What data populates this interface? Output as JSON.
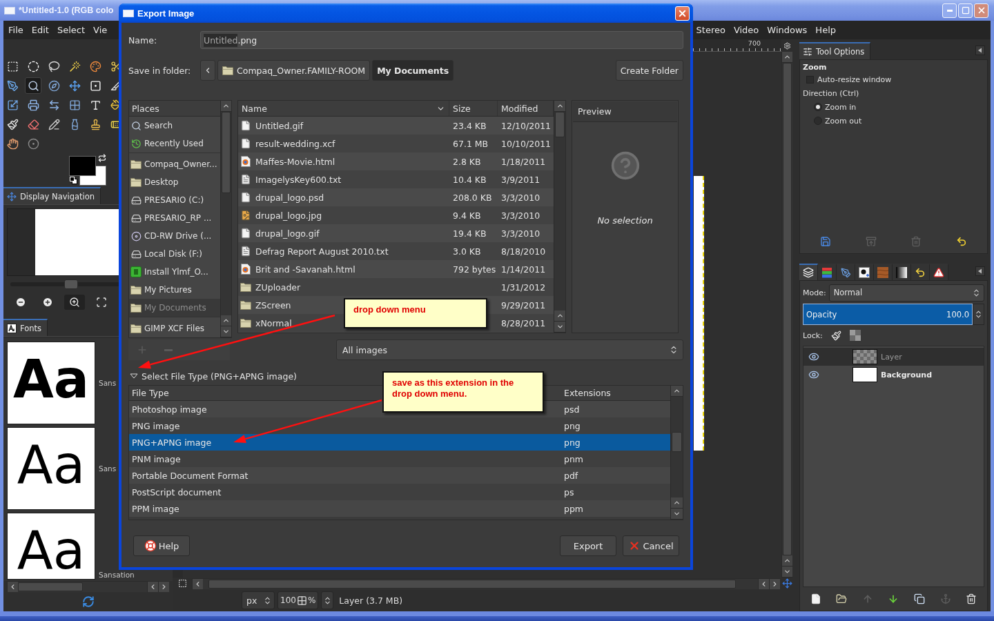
{
  "gimp_window": {
    "title": "*Untitled-1.0 (RGB colo",
    "menu_left": [
      "File",
      "Edit",
      "Select",
      "Vie"
    ],
    "menu_right": [
      "Stereo",
      "Video",
      "Windows",
      "Help"
    ]
  },
  "toolbox": {
    "tools": [
      {
        "kind": "rectangle",
        "selected": false
      },
      {
        "kind": "ellipse",
        "selected": false
      },
      {
        "kind": "lasso",
        "selected": false
      },
      {
        "kind": "wand",
        "selected": false
      },
      {
        "kind": "bycolor",
        "selected": false
      },
      {
        "kind": "scissors",
        "selected": false
      },
      {
        "kind": "paths",
        "selected": false
      },
      {
        "kind": "zoom",
        "selected": true
      },
      {
        "kind": "measure",
        "selected": false
      },
      {
        "kind": "move",
        "selected": false
      },
      {
        "kind": "align",
        "selected": false
      },
      {
        "kind": "crop",
        "selected": false
      },
      {
        "kind": "transform",
        "selected": false
      },
      {
        "kind": "perspective",
        "selected": false
      },
      {
        "kind": "flip",
        "selected": false
      },
      {
        "kind": "cage",
        "selected": false
      },
      {
        "kind": "text",
        "selected": false
      },
      {
        "kind": "bucket",
        "selected": false
      },
      {
        "kind": "brush",
        "selected": false
      },
      {
        "kind": "eraser",
        "selected": false
      },
      {
        "kind": "pencil",
        "selected": false
      },
      {
        "kind": "ink",
        "selected": false
      },
      {
        "kind": "clone",
        "selected": false
      },
      {
        "kind": "heal",
        "selected": false
      },
      {
        "kind": "smudge",
        "selected": false
      },
      {
        "kind": "dodge",
        "selected": false
      }
    ]
  },
  "navigation": {
    "tab": "Display Navigation",
    "level": 0.55,
    "buttons": [
      {
        "kind": "zoomout",
        "selected": false
      },
      {
        "kind": "zoomin",
        "selected": false
      },
      {
        "kind": "actual",
        "selected": true
      },
      {
        "kind": "fit",
        "selected": false
      }
    ]
  },
  "fonts": {
    "tab": "Fonts",
    "items": [
      {
        "sample": "Aa",
        "name": "Sans",
        "kind": "bold"
      },
      {
        "sample": "Aa",
        "name": "Sans",
        "kind": "regular"
      },
      {
        "sample": "Aa",
        "name": "Sansation",
        "kind": "regular"
      }
    ]
  },
  "canvas": {
    "ruler_label": "700"
  },
  "status_bar": {
    "unit": "px",
    "zoom": "100",
    "zoom_unit": "%",
    "info": "Layer (3.7 MB)"
  },
  "dock": {
    "tool_options": {
      "tab": "Tool Options",
      "tool": "Zoom",
      "auto_resize": {
        "label": "Auto-resize window",
        "checked": false
      },
      "direction_label": "Direction (Ctrl)",
      "direction": [
        {
          "label": "Zoom in",
          "selected": true
        },
        {
          "label": "Zoom out",
          "selected": false
        }
      ],
      "buttons": [
        {
          "kind": "save",
          "disabled": false
        },
        {
          "kind": "restore",
          "disabled": true
        },
        {
          "kind": "delete",
          "disabled": true
        },
        {
          "kind": "reset",
          "disabled": false
        }
      ]
    },
    "tabs": [
      {
        "kind": "layers",
        "selected": true
      },
      {
        "kind": "channels",
        "selected": false
      },
      {
        "kind": "paths",
        "selected": false
      },
      {
        "kind": "brushes",
        "selected": false
      },
      {
        "kind": "patterns",
        "selected": false
      },
      {
        "kind": "gradients",
        "selected": false
      },
      {
        "kind": "undo",
        "selected": false
      },
      {
        "kind": "errors",
        "selected": false
      }
    ],
    "mode": {
      "label": "Mode:",
      "value": "Normal"
    },
    "opacity": {
      "label": "Opacity",
      "value": "100.0",
      "level": 1
    },
    "lock_label": "Lock:",
    "layers": [
      {
        "name": "Layer",
        "visible": true,
        "selected": true,
        "has_alpha": true
      },
      {
        "name": "Background",
        "visible": true,
        "selected": false,
        "has_alpha": false
      }
    ],
    "buttons": [
      {
        "kind": "new",
        "disabled": false
      },
      {
        "kind": "open",
        "disabled": false
      },
      {
        "kind": "raise",
        "disabled": true
      },
      {
        "kind": "lower",
        "disabled": false
      },
      {
        "kind": "duplicate",
        "disabled": false
      },
      {
        "kind": "anchor",
        "disabled": true
      },
      {
        "kind": "delete",
        "disabled": false
      }
    ]
  },
  "dialog": {
    "title": "Export Image",
    "name_label": "Name:",
    "name_value": [
      {
        "text": "Untitled",
        "selected": true
      },
      {
        "text": ".png",
        "selected": false
      }
    ],
    "folder_label": "Save in folder:",
    "path": [
      {
        "label": "Compaq_Owner.FAMILY-ROOM",
        "selected": false
      },
      {
        "label": "My Documents",
        "selected": true
      }
    ],
    "create_folder": "Create Folder",
    "places": {
      "title": "Places",
      "groups": [
        {
          "items": [
            {
              "label": "Search",
              "kind": "search",
              "selected": false
            },
            {
              "label": "Recently Used",
              "kind": "recent",
              "selected": false
            }
          ]
        },
        {
          "items": [
            {
              "label": "Compaq_Owner...",
              "kind": "folder",
              "selected": false
            },
            {
              "label": "Desktop",
              "kind": "folder",
              "selected": false
            },
            {
              "label": "PRESARIO (C:)",
              "kind": "drive",
              "selected": false
            },
            {
              "label": "PRESARIO_RP ...",
              "kind": "drive",
              "selected": false
            },
            {
              "label": "CD-RW Drive (...",
              "kind": "cdrom",
              "selected": false
            },
            {
              "label": "Local Disk (F:)",
              "kind": "drive",
              "selected": false
            },
            {
              "label": "Install Ylmf_O...",
              "kind": "app",
              "selected": false
            },
            {
              "label": "My Pictures",
              "kind": "folder",
              "selected": false
            },
            {
              "label": "My Documents",
              "kind": "folder",
              "selected": true
            }
          ]
        },
        {
          "items": [
            {
              "label": "GIMP XCF Files",
              "kind": "folder",
              "selected": false
            }
          ]
        }
      ],
      "buttons": [
        {
          "kind": "add",
          "disabled": true
        },
        {
          "kind": "remove",
          "disabled": true
        }
      ]
    },
    "files": {
      "columns": [
        {
          "label": "Name",
          "sorted": true
        },
        {
          "label": "Size",
          "sorted": false
        },
        {
          "label": "Modified",
          "sorted": false
        }
      ],
      "rows": [
        {
          "kind": "file",
          "name": "Untitled.gif",
          "size": "23.4 KB",
          "modified": "12/10/2011"
        },
        {
          "kind": "file",
          "name": "result-wedding.xcf",
          "size": "67.1 MB",
          "modified": "10/10/2011"
        },
        {
          "kind": "web",
          "name": "Maffes-Movie.html",
          "size": "2.8 KB",
          "modified": "1/18/2011"
        },
        {
          "kind": "text",
          "name": "ImagelysKey600.txt",
          "size": "10.4 KB",
          "modified": "3/9/2011"
        },
        {
          "kind": "file",
          "name": "drupal_logo.psd",
          "size": "208.0 KB",
          "modified": "3/3/2010"
        },
        {
          "kind": "image",
          "name": "drupal_logo.jpg",
          "size": "9.4 KB",
          "modified": "3/3/2010"
        },
        {
          "kind": "file",
          "name": "drupal_logo.gif",
          "size": "19.4 KB",
          "modified": "3/3/2010"
        },
        {
          "kind": "text",
          "name": "Defrag Report August 2010.txt",
          "size": "3.0 KB",
          "modified": "8/18/2010"
        },
        {
          "kind": "web",
          "name": "Brit and -Savanah.html",
          "size": "792 bytes",
          "modified": "1/14/2011"
        },
        {
          "kind": "folder",
          "name": "ZUploader",
          "modified": "1/31/2012"
        },
        {
          "kind": "folder",
          "name": "ZScreen",
          "modified": "9/29/2011"
        },
        {
          "kind": "folder",
          "name": "xNormal",
          "modified": "8/28/2011"
        }
      ]
    },
    "preview": {
      "title": "Preview",
      "message": "No selection"
    },
    "filter": "All images",
    "file_type": {
      "label": "Select File Type (PNG+APNG image)",
      "expanded": true,
      "columns": [
        "File Type",
        "Extensions"
      ],
      "rows": [
        {
          "type": "Photoshop image",
          "ext": "psd",
          "selected": false
        },
        {
          "type": "PNG image",
          "ext": "png",
          "selected": false
        },
        {
          "type": "PNG+APNG image",
          "ext": "png",
          "selected": true
        },
        {
          "type": "PNM image",
          "ext": "pnm",
          "selected": false
        },
        {
          "type": "Portable Document Format",
          "ext": "pdf",
          "selected": false
        },
        {
          "type": "PostScript document",
          "ext": "ps",
          "selected": false
        },
        {
          "type": "PPM image",
          "ext": "ppm",
          "selected": false
        }
      ]
    },
    "buttons": [
      {
        "kind": "help",
        "label": "Help"
      },
      {
        "kind": "export",
        "label": "Export"
      },
      {
        "kind": "cancel",
        "label": "Cancel"
      }
    ]
  },
  "annotations": [
    {
      "text": "drop down menu"
    },
    {
      "text": "save as this extension in the drop down menu."
    }
  ]
}
